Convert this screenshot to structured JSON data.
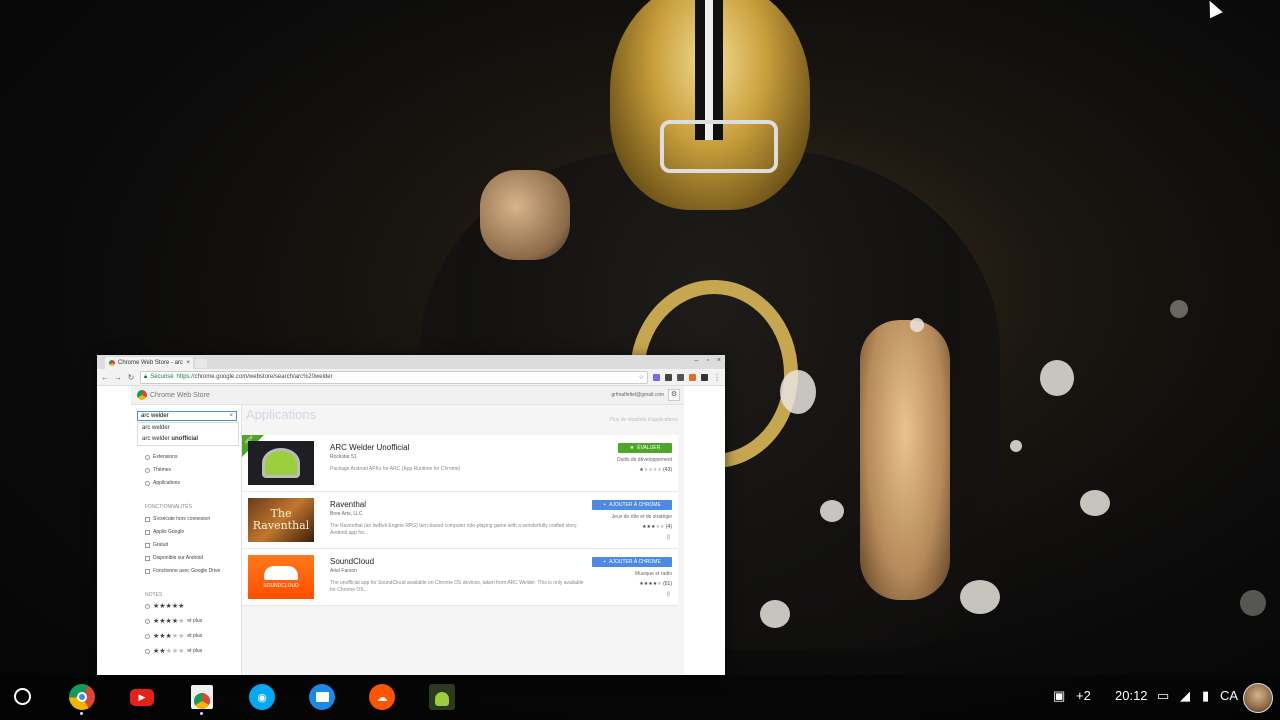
{
  "browser": {
    "tab_title": "Chrome Web Store - arc",
    "secure_label": "Sécurisé",
    "url_scheme": "https://",
    "url_rest": "chrome.google.com/webstore/search/arc%20welder",
    "window_controls": [
      "–",
      "▫",
      "×"
    ]
  },
  "store": {
    "logo_text": "Chrome Web Store",
    "account": "grfmaflettel@gmail.com",
    "search_value": "arc welder",
    "suggestions": [
      {
        "prefix": "arc welder",
        "bold": ""
      },
      {
        "prefix": "arc welder ",
        "bold": "unofficial"
      }
    ],
    "categories": [
      "Extensions",
      "Thèmes",
      "Applications"
    ],
    "features_heading": "FONCTIONNALITÉS",
    "features": [
      "S'exécute hors connexion",
      "Applis Google",
      "Gratuit",
      "Disponible sur Android",
      "Fonctionne avec Google Drive"
    ],
    "ratings_heading": "NOTES",
    "rating_filters": [
      {
        "stars": 5,
        "suffix": ""
      },
      {
        "stars": 4,
        "suffix": "et plus"
      },
      {
        "stars": 3,
        "suffix": "et plus"
      },
      {
        "stars": 2,
        "suffix": "et plus"
      }
    ],
    "section_heading": "Applications",
    "more_results": "Plus de résultats d'applications",
    "results": [
      {
        "title": "ARC Welder Unofficial",
        "author": "Rockstar 51",
        "description": "Package Android APKs for ARC (App Runtime for Chrome)",
        "button": "ÉVALUER",
        "button_color": "#4fa62a",
        "category": "Outils de développement",
        "stars": 1,
        "rating_count": "(43)",
        "ribbon": "NEW"
      },
      {
        "title": "Raventhal",
        "author": "Bree Arts, LLC",
        "description": "The Raventhal (an IwiBeli Engine RPG) turn-based computer role-playing game with a wonderfully crafted story. Android app for...",
        "button": "AJOUTER À CHROME",
        "button_color": "#4d8ae6",
        "category": "Jeux de rôle et de stratégie",
        "stars": 3,
        "rating_count": "(4)",
        "thumb_text": "The Raventhal"
      },
      {
        "title": "SoundCloud",
        "author": "Ariel Farson",
        "description": "The unofficial app for SoundCloud available on Chrome OS devices, taken from ARC Welder. This is only available for Chrome OS...",
        "button": "AJOUTER À CHROME",
        "button_color": "#4d8ae6",
        "category": "Musique et radio",
        "stars": 4,
        "rating_count": "(51)",
        "thumb_text": "SOUNDCLOUD"
      }
    ]
  },
  "shelf": {
    "apps": [
      "chrome-icon",
      "youtube-icon",
      "web-store-icon",
      "camera-icon",
      "files-icon",
      "soundcloud-icon",
      "arc-welder-icon"
    ],
    "notification_count": "+2",
    "time": "20:12",
    "locale": "CA"
  }
}
